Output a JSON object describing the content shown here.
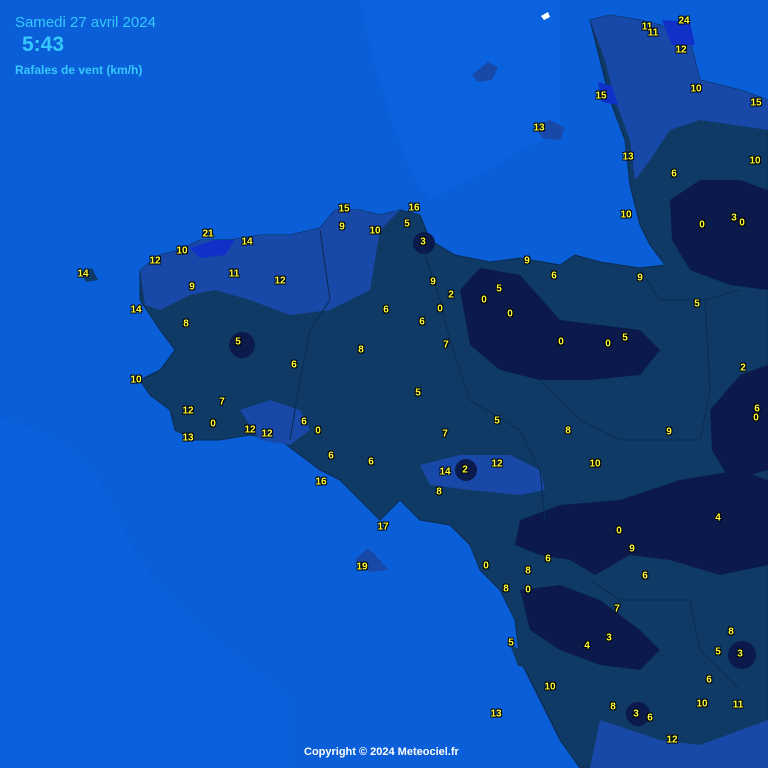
{
  "header": {
    "date": "Samedi 27 avril 2024",
    "time": "5:43",
    "variable": "Rafales de vent (km/h)"
  },
  "footer": {
    "copyright": "Copyright © 2024 Meteociel.fr"
  },
  "colors": {
    "sea": "#0a5fd8",
    "land_low": "#0f3a66",
    "land_mid": "#1848a8",
    "land_calm": "#0b1a4a",
    "land_strong": "#1030c8",
    "label": "#ffff33"
  },
  "values": [
    "24",
    "11",
    "11",
    "12",
    "15",
    "10",
    "15",
    "13",
    "13",
    "10",
    "6",
    "3",
    "0",
    "0",
    "15",
    "16",
    "9",
    "10",
    "5",
    "3",
    "21",
    "10",
    "14",
    "12",
    "11",
    "12",
    "14",
    "9",
    "14",
    "9",
    "5",
    "2",
    "0",
    "0",
    "9",
    "6",
    "8",
    "6",
    "0",
    "6",
    "5",
    "8",
    "7",
    "0",
    "0",
    "5",
    "9",
    "5",
    "6",
    "2",
    "10",
    "7",
    "12",
    "0",
    "12",
    "12",
    "13",
    "6",
    "0",
    "5",
    "6",
    "0",
    "7",
    "5",
    "8",
    "9",
    "6",
    "16",
    "6",
    "14",
    "2",
    "12",
    "10",
    "8",
    "17",
    "0",
    "9",
    "4",
    "6",
    "19",
    "0",
    "8",
    "8",
    "0",
    "6",
    "7",
    "3",
    "4",
    "8",
    "5",
    "3",
    "5",
    "10",
    "6",
    "8",
    "3",
    "6",
    "10",
    "11",
    "13",
    "12",
    "10"
  ]
}
